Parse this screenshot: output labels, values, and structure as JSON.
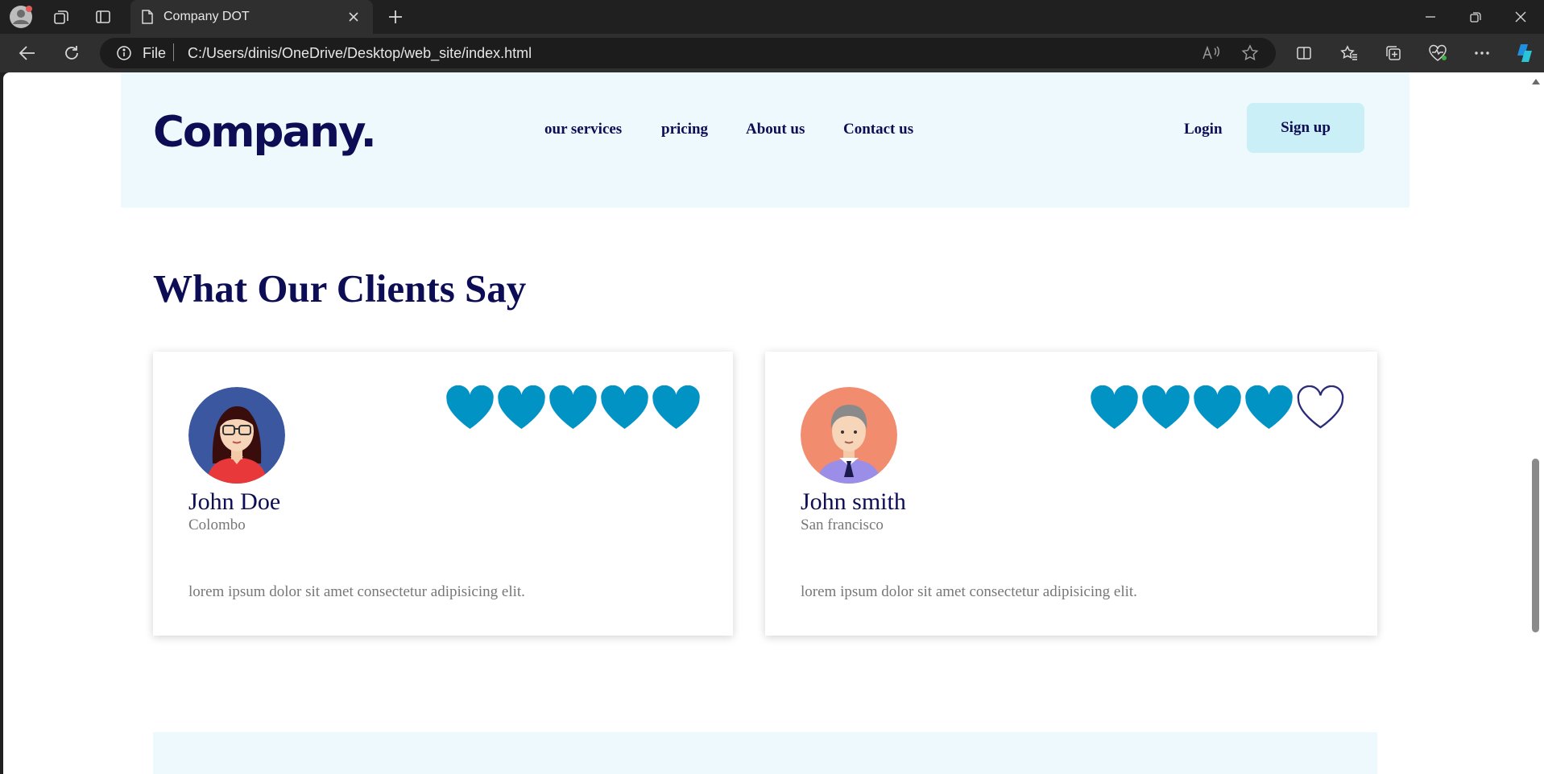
{
  "browser": {
    "tab_title": "Company DOT",
    "url_scheme": "File",
    "url": "C:/Users/dinis/OneDrive/Desktop/web_site/index.html"
  },
  "site": {
    "logo": "Company.",
    "nav": [
      "our services",
      "pricing",
      "About us",
      "Contact us"
    ],
    "login": "Login",
    "signup": "Sign up"
  },
  "testimonials": {
    "title": "What Our Clients Say",
    "cards": [
      {
        "name": "John Doe",
        "city": "Colombo",
        "quote": "lorem ipsum dolor sit amet consectetur adipisicing elit.",
        "rating": 5,
        "max_rating": 5
      },
      {
        "name": "John smith",
        "city": "San francisco",
        "quote": "lorem ipsum dolor sit amet consectetur adipisicing elit.",
        "rating": 4,
        "max_rating": 5
      }
    ]
  },
  "colors": {
    "brand_navy": "#0d0d55",
    "heart_filled": "#0093c4",
    "heart_empty_stroke": "#2b2b7a",
    "header_bg": "#eef9fd",
    "signup_bg": "#cbeff6"
  },
  "icons": [
    "profile-icon",
    "workspaces-icon",
    "tab-actions-icon",
    "page-icon",
    "close-icon",
    "new-tab-icon",
    "minimize-icon",
    "restore-icon",
    "window-close-icon",
    "back-icon",
    "refresh-icon",
    "info-icon",
    "read-aloud-icon",
    "favorite-star-icon",
    "split-screen-icon",
    "favorites-icon",
    "collections-icon",
    "browser-essentials-icon",
    "more-icon",
    "copilot-icon",
    "heart-icon"
  ]
}
